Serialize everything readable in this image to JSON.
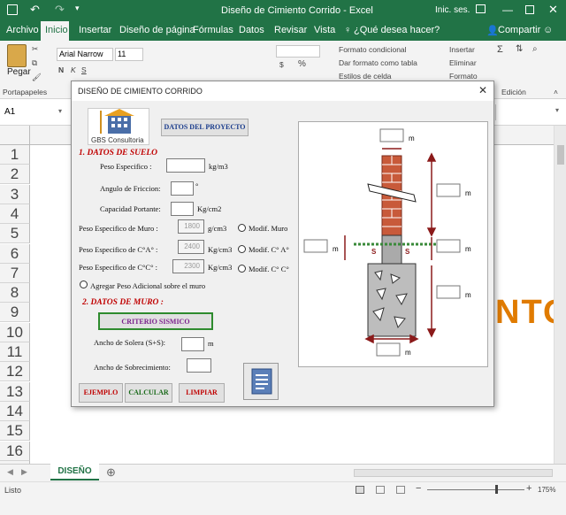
{
  "window": {
    "title": "Diseño de Cimiento Corrido  -  Excel",
    "account": "Inic. ses."
  },
  "ribbon_tabs": [
    "Archivo",
    "Inicio",
    "Insertar",
    "Diseño de página",
    "Fórmulas",
    "Datos",
    "Revisar",
    "Vista"
  ],
  "tell_me": "¿Qué desea hacer?",
  "share": "Compartir",
  "ribbon": {
    "paste": "Pegar",
    "clipboard_group": "Portapapeles",
    "font_name": "Arial Narrow",
    "font_size": "11",
    "conditional_format": "Formato condicional",
    "format_as_table": "Dar formato como tabla",
    "cell_styles": "Estilos de celda",
    "insert": "Insertar",
    "delete": "Eliminar",
    "format": "Formato",
    "editing_group": "Edición",
    "percent": "%"
  },
  "name_box": "A1",
  "row_numbers": [
    "1",
    "2",
    "3",
    "4",
    "5",
    "6",
    "7",
    "8",
    "9",
    "10",
    "11",
    "12",
    "13",
    "14",
    "15",
    "16",
    "17"
  ],
  "sheet_big_text": "NTO",
  "sheet_tab": "DISEÑO",
  "status": {
    "ready": "Listo",
    "zoom": "175%"
  },
  "dialog": {
    "title": "DISEÑO DE CIMIENTO CORRIDO",
    "logo_text": "GBS Consultoria",
    "project_button": "DATOS DEL PROYECTO",
    "section1": "1. DATOS DE SUELO",
    "peso_especifico": "Peso Especifico  :",
    "peso_unit": "kg/m3",
    "angulo": "Angulo de Friccion:",
    "angulo_unit": "°",
    "capacidad": "Capacidad Portante:",
    "capacidad_unit": "Kg/cm2",
    "peso_muro": "Peso Especifico de Muro :",
    "peso_muro_value": "1800",
    "peso_muro_unit": "g/cm3",
    "modif_muro": "Modif. Muro",
    "peso_ca": "Peso Especifico de C°A° :",
    "peso_ca_value": "2400",
    "peso_ca_unit": "Kg/cm3",
    "modif_ca": "Modif. C° A°",
    "peso_cc": "Peso Especifico de C°C°  :",
    "peso_cc_value": "2300",
    "peso_cc_unit": "Kg/cm3",
    "modif_cc": "Modif. C° C°",
    "peso_adicional": "Agregar Peso Adicional sobre el muro",
    "section2": "2. DATOS DE MURO :",
    "criterio_button": "CRITERIO SISMICO",
    "ancho_solera": "Ancho de Solera (S+S):",
    "ancho_solera_unit": "m",
    "ancho_sobrecimiento": "Ancho de Sobrecimiento:",
    "ejemplo": "EJEMPLO",
    "calcular": "CALCULAR",
    "limpiar": "LIMPIAR",
    "diagram": {
      "m": "m",
      "s": "S"
    }
  }
}
